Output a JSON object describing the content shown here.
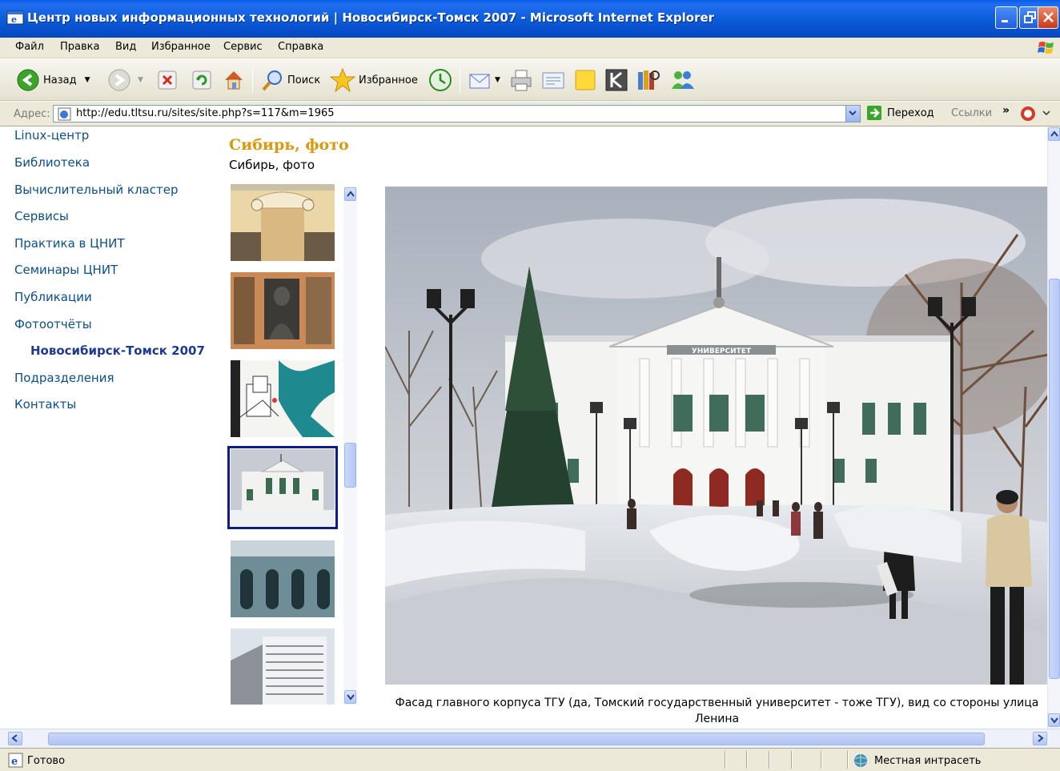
{
  "window": {
    "title": "Центр новых информационных технологий | Новосибирск-Томск 2007 - Microsoft Internet Explorer"
  },
  "menu": [
    "Файл",
    "Правка",
    "Вид",
    "Избранное",
    "Сервис",
    "Справка"
  ],
  "toolbar": {
    "back_label": "Назад",
    "search_label": "Поиск",
    "favorites_label": "Избранное"
  },
  "address": {
    "label": "Адрес:",
    "url": "http://edu.tltsu.ru/sites/site.php?s=117&m=1965",
    "go_label": "Переход",
    "links_label": "Ссылки"
  },
  "nav": [
    {
      "label": "Linux-центр"
    },
    {
      "label": "Библиотека"
    },
    {
      "label": "Вычислительный кластер"
    },
    {
      "label": "Сервисы"
    },
    {
      "label": "Практика в ЦНИТ"
    },
    {
      "label": "Семинары ЦНИТ"
    },
    {
      "label": "Публикации"
    },
    {
      "label": "Фотоотчёты"
    },
    {
      "label": "Новосибирск-Томск 2007",
      "active": true
    },
    {
      "label": "Подразделения"
    },
    {
      "label": "Контакты"
    }
  ],
  "gallery": {
    "heading": "Сибирь, фото",
    "subheading": "Сибирь, фото",
    "caption": "Фасад главного корпуса ТГУ (да, Томский государственный университет - тоже ТГУ), вид со стороны улица Ленина",
    "building_sign": "УНИВЕРСИТЕТ"
  },
  "status": {
    "text": "Готово",
    "zone": "Местная интрасеть"
  },
  "colors": {
    "titlebar": "#0a5de7",
    "link": "#0b4f8a",
    "heading": "#d79a10",
    "selected_thumb": "#0b1b8c"
  }
}
